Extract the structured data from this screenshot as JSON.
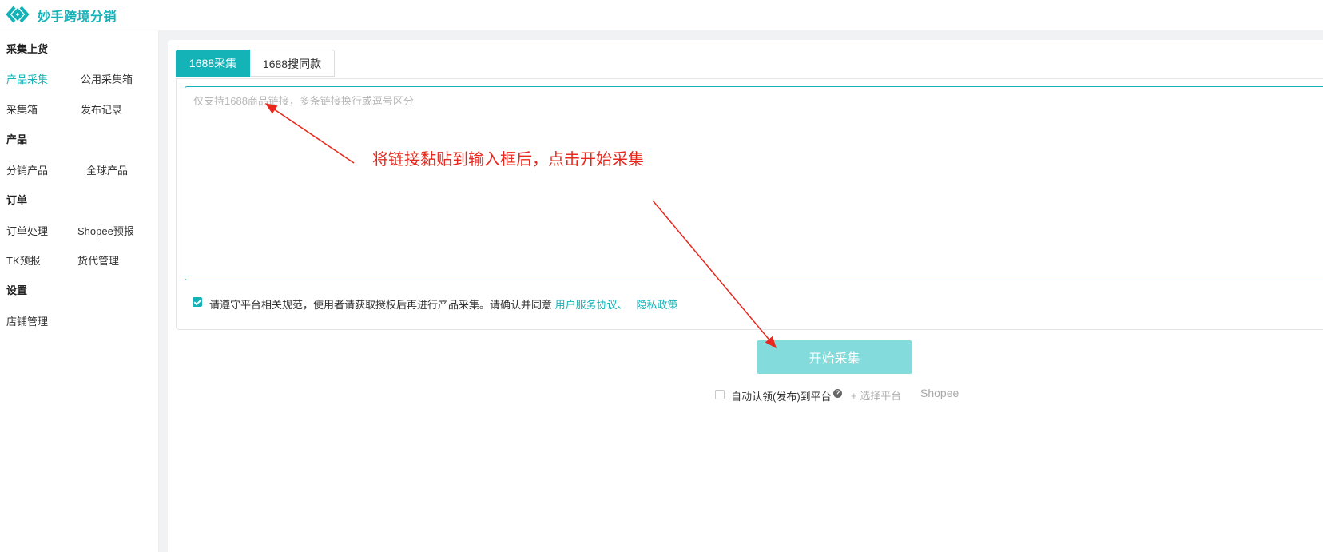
{
  "app": {
    "title": "妙手跨境分销"
  },
  "sidebar": {
    "sections": [
      {
        "title": "采集上货",
        "items": [
          "产品采集",
          "公用采集箱",
          "采集箱",
          "发布记录"
        ]
      },
      {
        "title": "产品",
        "items": [
          "分销产品",
          "全球产品"
        ]
      },
      {
        "title": "订单",
        "items": [
          "订单处理",
          "Shopee预报",
          "TK预报",
          "货代管理"
        ]
      },
      {
        "title": "设置",
        "items": [
          "店铺管理"
        ]
      }
    ],
    "active_item": "产品采集"
  },
  "tabs": [
    {
      "label": "1688采集",
      "active": true
    },
    {
      "label": "1688搜同款",
      "active": false
    }
  ],
  "link_input": {
    "value": "",
    "placeholder": "仅支持1688商品链接，多条链接换行或逗号区分"
  },
  "agreement": {
    "checked": true,
    "text": "请遵守平台相关规范，使用者请获取授权后再进行产品采集。请确认并同意 ",
    "link1": "用户服务协议、",
    "link2": "隐私政策"
  },
  "start_button": {
    "label": "开始采集"
  },
  "auto_publish": {
    "checked": false,
    "label": "自动认领(发布)到平台",
    "help_icon": "question-circle-icon",
    "select_label": "+ 选择平台",
    "platform": "Shopee"
  },
  "annotation": {
    "text": "将链接黏贴到输入框后，点击开始采集"
  },
  "colors": {
    "accent": "#14b3b8",
    "button_disabled": "#84dbdc",
    "annotation": "#e8281e",
    "content_bg": "#f1f2f4"
  }
}
